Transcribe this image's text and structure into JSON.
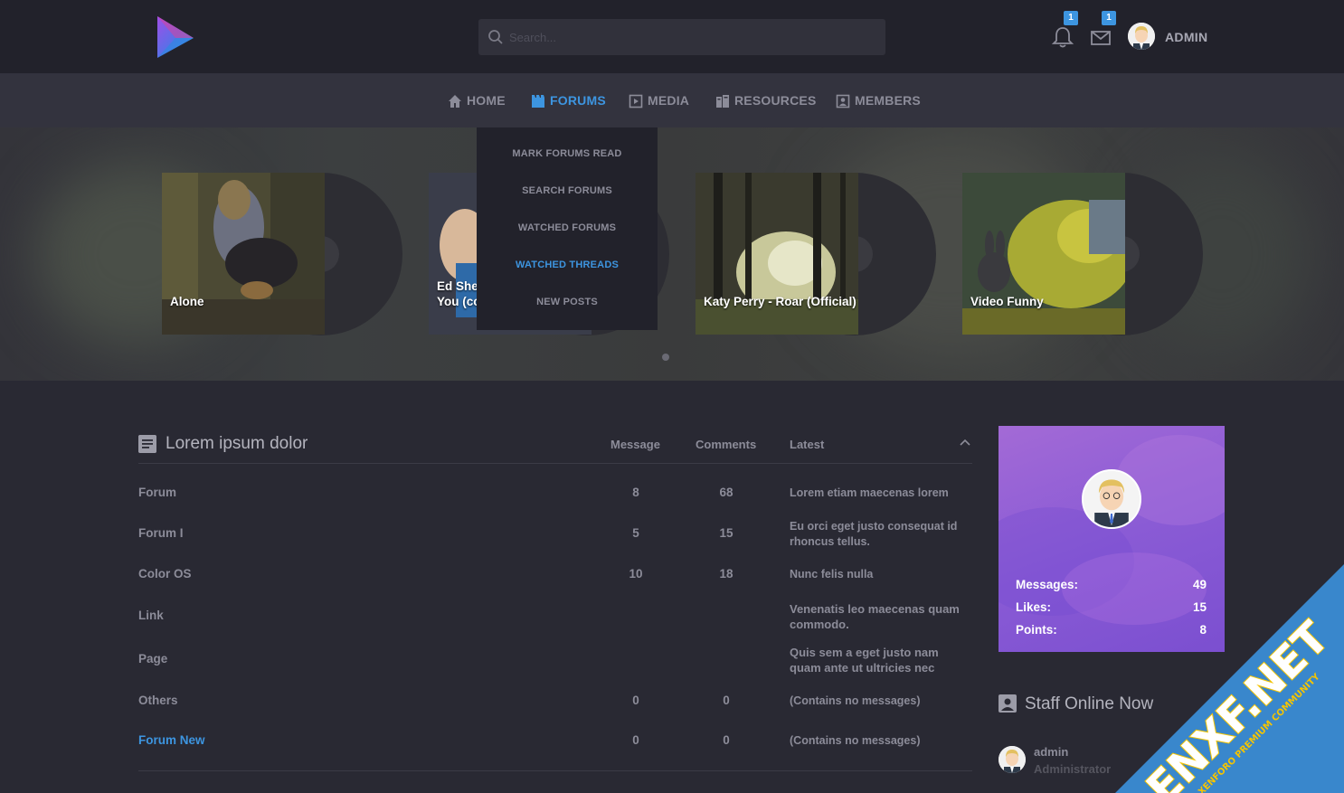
{
  "header": {
    "search_placeholder": "Search...",
    "notifications_count": "1",
    "messages_count": "1",
    "user_name": "ADMIN"
  },
  "nav": {
    "items": [
      {
        "label": "HOME",
        "icon": "home-icon"
      },
      {
        "label": "FORUMS",
        "icon": "forums-icon"
      },
      {
        "label": "MEDIA",
        "icon": "media-icon"
      },
      {
        "label": "RESOURCES",
        "icon": "resources-icon"
      },
      {
        "label": "MEMBERS",
        "icon": "members-icon"
      }
    ],
    "active_item": "FORUMS"
  },
  "dropdown": {
    "items": [
      "MARK FORUMS READ",
      "SEARCH FORUMS",
      "WATCHED FORUMS",
      "WATCHED THREADS",
      "NEW POSTS"
    ],
    "active_item": "WATCHED THREADS"
  },
  "slider": {
    "cards": [
      {
        "caption": "Alone"
      },
      {
        "caption": "Ed Sheeran - Shape Of You (co"
      },
      {
        "caption": "Katy Perry - Roar (Official)"
      },
      {
        "caption": "Video Funny"
      }
    ]
  },
  "forum": {
    "title": "Lorem ipsum dolor",
    "columns": [
      "Message",
      "Comments",
      "Latest"
    ],
    "rows": [
      {
        "name": "Forum",
        "message": "8",
        "comments": "68",
        "latest": "Lorem etiam maecenas lorem"
      },
      {
        "name": "Forum I",
        "message": "5",
        "comments": "15",
        "latest": "Eu orci eget justo consequat id rhoncus tellus."
      },
      {
        "name": "Color OS",
        "message": "10",
        "comments": "18",
        "latest": "Nunc felis nulla"
      },
      {
        "name": "Link",
        "message": "",
        "comments": "",
        "latest": "Venenatis leo maecenas quam commodo."
      },
      {
        "name": "Page",
        "message": "",
        "comments": "",
        "latest": "Quis sem a eget justo nam quam ante ut ultricies nec"
      },
      {
        "name": "Others",
        "message": "0",
        "comments": "0",
        "latest": "(Contains no messages)"
      },
      {
        "name": "Forum New",
        "message": "0",
        "comments": "0",
        "latest": "(Contains no messages)"
      }
    ]
  },
  "profile": {
    "stats": [
      {
        "label": "Messages:",
        "value": "49"
      },
      {
        "label": "Likes:",
        "value": "15"
      },
      {
        "label": "Points:",
        "value": "8"
      }
    ]
  },
  "staff": {
    "title": "Staff Online Now",
    "members": [
      {
        "name": "admin",
        "role": "Administrator"
      }
    ]
  },
  "watermark": {
    "main": "ENXF.NET",
    "sub": "XENFORO PREMIUM COMMUNITY"
  },
  "colors": {
    "accent": "#3d95e0",
    "profile_start": "#a36ad6",
    "profile_end": "#7b4fd0",
    "watermark": "#3b8fd9"
  }
}
